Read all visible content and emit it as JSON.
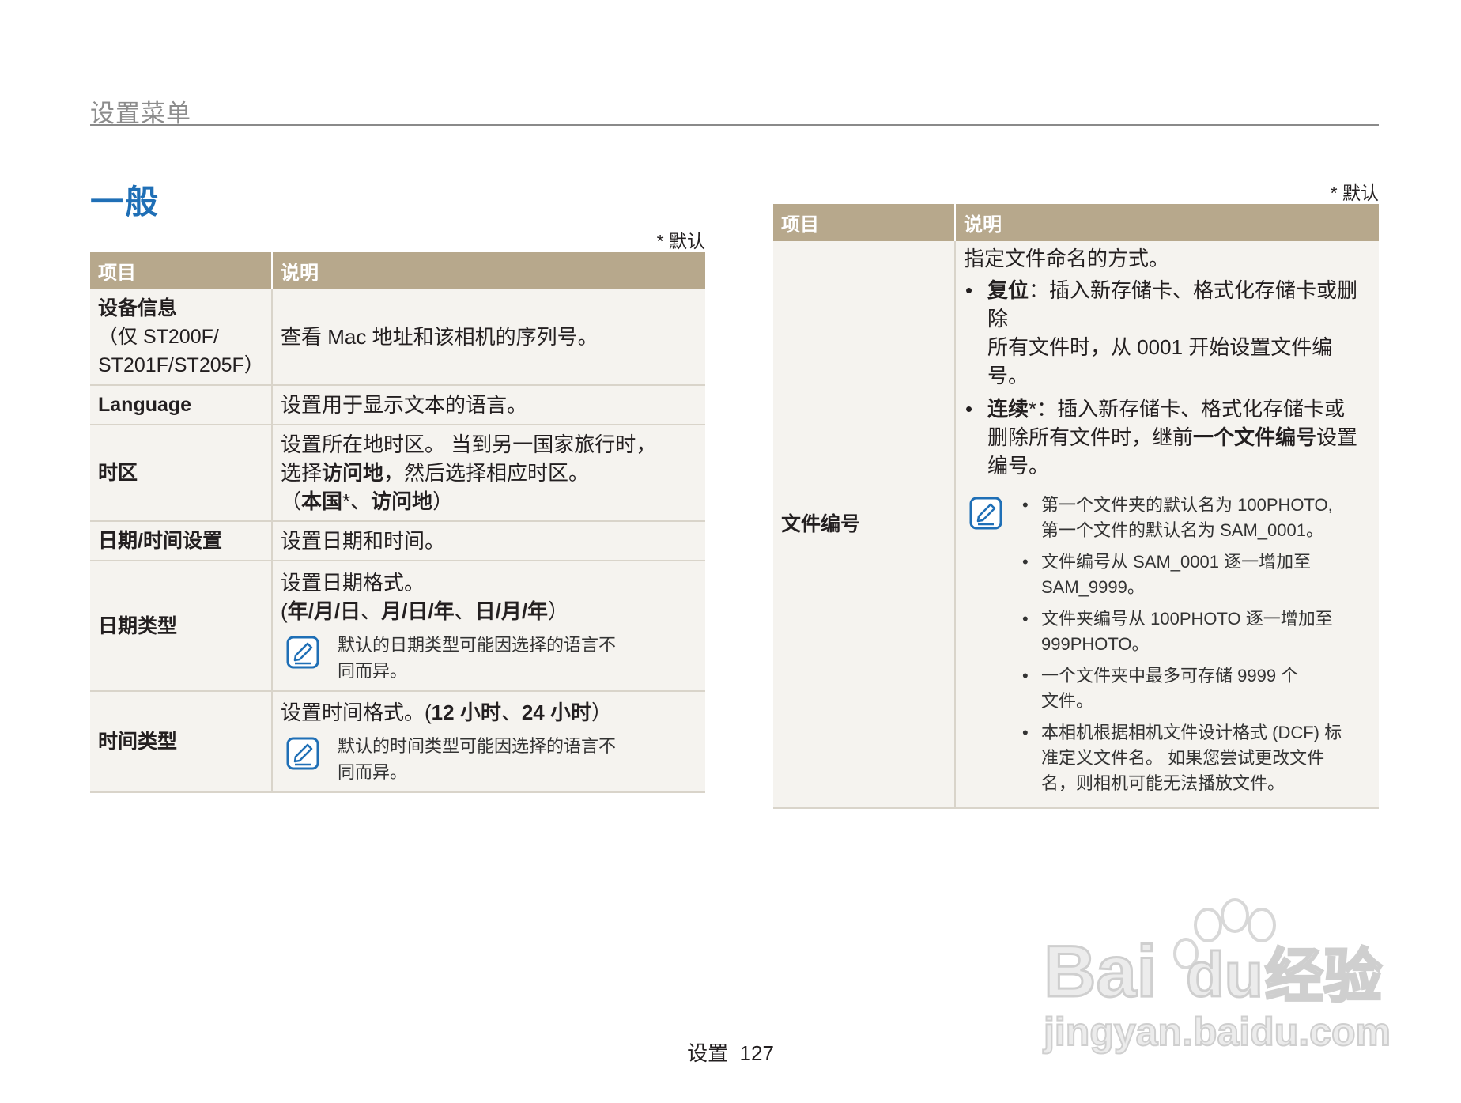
{
  "header": {
    "title": "设置菜单"
  },
  "section": {
    "title": "一般"
  },
  "default_note": "* 默认",
  "table_headers": {
    "item": "项目",
    "desc": "说明"
  },
  "left_rows": {
    "device": {
      "item": "设备信息",
      "item_sub_1": "（仅 ST200F/",
      "item_sub_2": "ST201F/ST205F）",
      "desc": "查看 Mac 地址和该相机的序列号。"
    },
    "language": {
      "item": "Language",
      "desc": "设置用于显示文本的语言。"
    },
    "timezone": {
      "item": "时区",
      "desc_1": "设置所在地时区。 当到另一国家旅行时，",
      "desc_2a": "选择",
      "desc_2b": "访问地",
      "desc_2c": "，然后选择相应时区。",
      "desc_3a": "（",
      "desc_3b": "本国",
      "desc_3c": "*、",
      "desc_3d": "访问地",
      "desc_3e": "）"
    },
    "datetime": {
      "item": "日期/时间设置",
      "desc": "设置日期和时间。"
    },
    "datetype": {
      "item": "日期类型",
      "desc_1": "设置日期格式。",
      "desc_2a": "(",
      "desc_2b": "年/月/日",
      "desc_2c": "、",
      "desc_2d": "月/日/年",
      "desc_2e": "、",
      "desc_2f": "日/月/年",
      "desc_2g": "）",
      "note_1": "默认的日期类型可能因选择的语言不",
      "note_2": "同而异。"
    },
    "timetype": {
      "item": "时间类型",
      "desc_1a": "设置时间格式。(",
      "desc_1b": "12 小时",
      "desc_1c": "、",
      "desc_1d": "24 小时",
      "desc_1e": "）",
      "note_1": "默认的时间类型可能因选择的语言不",
      "note_2": "同而异。"
    }
  },
  "right_row": {
    "item": "文件编号",
    "intro": "指定文件命名的方式。",
    "reset_label": "复位",
    "reset_text_1": "：插入新存储卡、格式化存储卡或删除",
    "reset_text_2": "所有文件时，从 0001 开始设置文件编号。",
    "cont_label": "连续",
    "cont_text_1": "*：插入新存储卡、格式化存储卡或",
    "cont_text_2a": "删除所有文件时，继前",
    "cont_text_2b": "一个文件编号",
    "cont_text_2c": "设置",
    "cont_text_3": "编号。",
    "notes": [
      {
        "l1": "第一个文件夹的默认名为 100PHOTO,",
        "l2": "第一个文件的默认名为 SAM_0001。"
      },
      {
        "l1": "文件编号从 SAM_0001 逐一增加至",
        "l2": "SAM_9999。"
      },
      {
        "l1": "文件夹编号从 100PHOTO 逐一增加至",
        "l2": "999PHOTO。"
      },
      {
        "l1": "一个文件夹中最多可存储 9999 个",
        "l2": "文件。"
      },
      {
        "l1": "本相机根据相机文件设计格式 (DCF) 标",
        "l2": "准定义文件名。 如果您尝试更改文件",
        "l3": "名，则相机可能无法播放文件。"
      }
    ]
  },
  "footer": {
    "page_label": "设置",
    "page_number": "127"
  },
  "watermark": {
    "brand": "Bai",
    "brand2": "du",
    "brand_cn": "经验",
    "url": "jingyan.baidu.com"
  },
  "colors": {
    "accent": "#1f6fb6",
    "table_header": "#b7a88c",
    "row_bg": "#f5f3ef"
  }
}
